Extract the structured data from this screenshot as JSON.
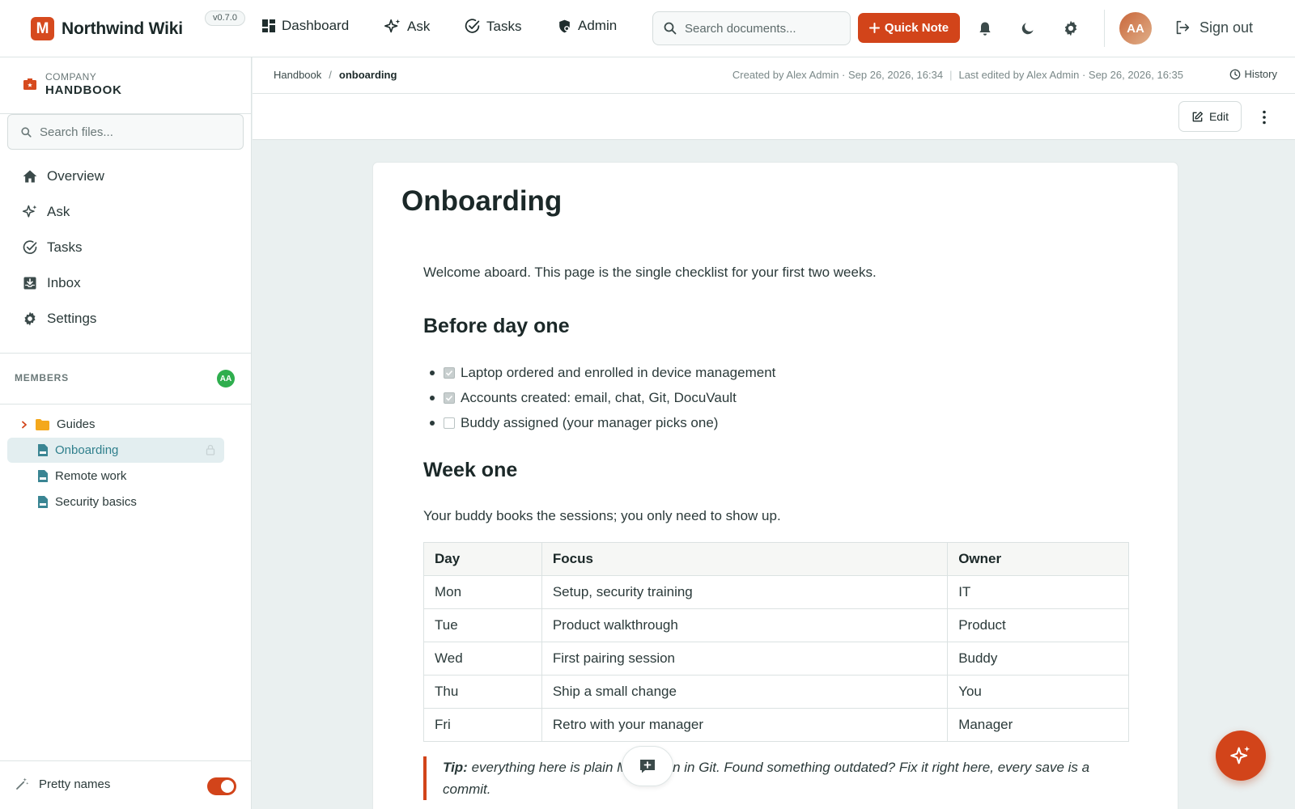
{
  "app": {
    "name": "Northwind Wiki",
    "logo_letter": "M",
    "version": "v0.7.0"
  },
  "topnav": [
    {
      "label": "Dashboard",
      "icon": "dashboard-icon"
    },
    {
      "label": "Ask",
      "icon": "sparkles-icon"
    },
    {
      "label": "Tasks",
      "icon": "check-circle-icon"
    },
    {
      "label": "Admin",
      "icon": "shield-gear-icon"
    }
  ],
  "search": {
    "placeholder": "Search documents..."
  },
  "quick_note": {
    "label": "Quick Note"
  },
  "user": {
    "initials": "AA",
    "signout_label": "Sign out"
  },
  "colors": {
    "accent": "#d2441a",
    "active_bg": "#e3eef0",
    "member_badge": "#2fae4e"
  },
  "sidebar": {
    "space": {
      "kicker": "COMPANY",
      "name": "HANDBOOK"
    },
    "search_placeholder": "Search files...",
    "nav": [
      {
        "label": "Overview",
        "icon": "home-icon"
      },
      {
        "label": "Ask",
        "icon": "sparkles-icon"
      },
      {
        "label": "Tasks",
        "icon": "check-circle-icon"
      },
      {
        "label": "Inbox",
        "icon": "inbox-icon"
      },
      {
        "label": "Settings",
        "icon": "gear-icon"
      }
    ],
    "members_label": "MEMBERS",
    "members_initials": "AA",
    "tree": [
      {
        "label": "Guides",
        "type": "folder"
      },
      {
        "label": "Onboarding",
        "type": "file",
        "active": true,
        "locked": true
      },
      {
        "label": "Remote work",
        "type": "file"
      },
      {
        "label": "Security basics",
        "type": "file"
      }
    ],
    "pretty_names": {
      "label": "Pretty names",
      "enabled": true
    }
  },
  "breadcrumb": {
    "root": "Handbook",
    "separator": "/",
    "current": "onboarding"
  },
  "meta": {
    "created": "Created by Alex Admin · Sep 26, 2026, 16:34",
    "sep": "|",
    "edited": "Last edited by Alex Admin · Sep 26, 2026, 16:35",
    "history_label": "History"
  },
  "toolbar": {
    "edit_label": "Edit"
  },
  "doc": {
    "title": "Onboarding",
    "intro": "Welcome aboard. This page is the single checklist for your first two weeks.",
    "section1": {
      "heading": "Before day one",
      "items": [
        {
          "text": "Laptop ordered and enrolled in device management",
          "checked": true
        },
        {
          "text": "Accounts created: email, chat, Git, DocuVault",
          "checked": true
        },
        {
          "text": "Buddy assigned (your manager picks one)",
          "checked": false
        }
      ]
    },
    "section2": {
      "heading": "Week one",
      "paragraph": "Your buddy books the sessions; you only need to show up.",
      "table": {
        "headers": [
          "Day",
          "Focus",
          "Owner"
        ],
        "rows": [
          [
            "Mon",
            "Setup, security training",
            "IT"
          ],
          [
            "Tue",
            "Product walkthrough",
            "Product"
          ],
          [
            "Wed",
            "First pairing session",
            "Buddy"
          ],
          [
            "Thu",
            "Ship a small change",
            "You"
          ],
          [
            "Fri",
            "Retro with your manager",
            "Manager"
          ]
        ]
      }
    },
    "tip": {
      "label": "Tip:",
      "text": "everything here is plain Markdown in Git. Found something outdated? Fix it right here, every save is a commit."
    }
  }
}
